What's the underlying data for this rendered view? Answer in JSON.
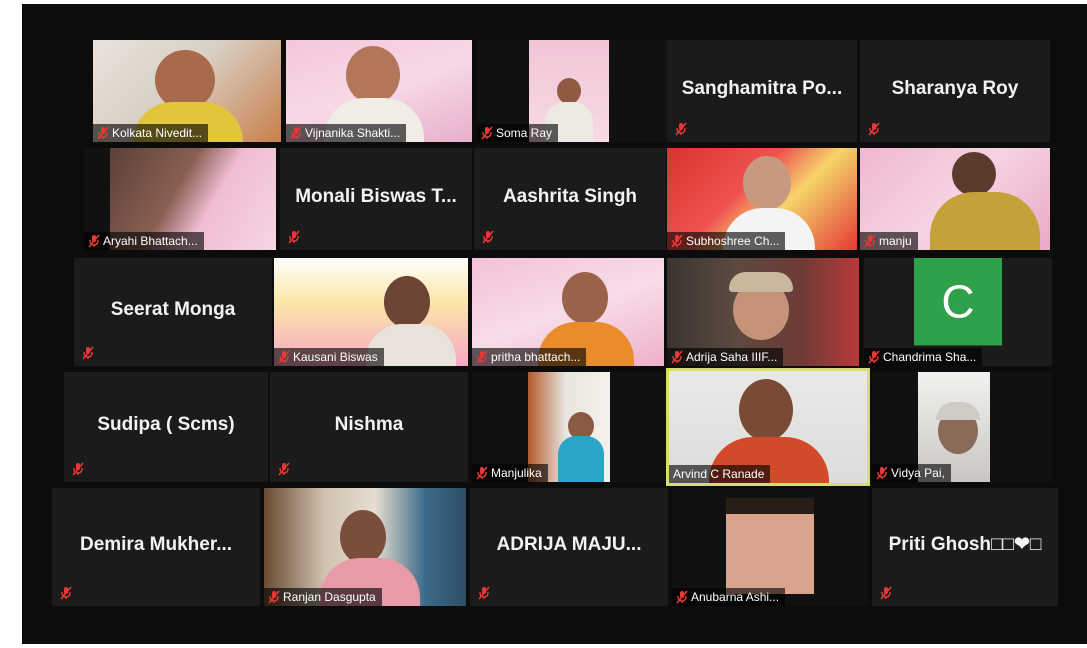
{
  "participants": [
    {
      "name": "Kolkata Nivedit...",
      "video": true
    },
    {
      "name": "Vijnanika Shakti...",
      "video": true
    },
    {
      "name": "Soma Ray",
      "video": true
    },
    {
      "name": "Sanghamitra  Po...",
      "video": false
    },
    {
      "name": "Sharanya Roy",
      "video": false
    },
    {
      "name": "Aryahi Bhattach...",
      "video": true
    },
    {
      "name": "Monali Biswas T...",
      "video": false
    },
    {
      "name": "Aashrita Singh",
      "video": false
    },
    {
      "name": "Subhoshree Ch...",
      "video": true
    },
    {
      "name": "manju",
      "video": true
    },
    {
      "name": "Seerat Monga",
      "video": false
    },
    {
      "name": "Kausani Biswas",
      "video": true
    },
    {
      "name": "pritha bhattach...",
      "video": true
    },
    {
      "name": "Adrija Saha IIIF...",
      "video": true
    },
    {
      "name": "Chandrima Sha...",
      "video": false,
      "avatar_letter": "C"
    },
    {
      "name": "Sudipa ( Scms)",
      "video": false
    },
    {
      "name": "Nishma",
      "video": false
    },
    {
      "name": "Manjulika",
      "video": true
    },
    {
      "name": "Arvind C Ranade",
      "video": true,
      "active_speaker": true
    },
    {
      "name": "Vidya Pai,",
      "video": true
    },
    {
      "name": "Demira  Mukher...",
      "video": false
    },
    {
      "name": "Ranjan Dasgupta",
      "video": true
    },
    {
      "name": "ADRIJA  MAJU...",
      "video": false
    },
    {
      "name": "Anubarna Ashi...",
      "video": true
    },
    {
      "name": "Priti Ghosh□□❤□",
      "video": false
    }
  ],
  "colors": {
    "muted_icon": "#e53935",
    "active_speaker_border": "#d8dc6a",
    "avatar_bg": "#2ea14a"
  },
  "icons": {
    "muted": "microphone-muted-icon"
  }
}
